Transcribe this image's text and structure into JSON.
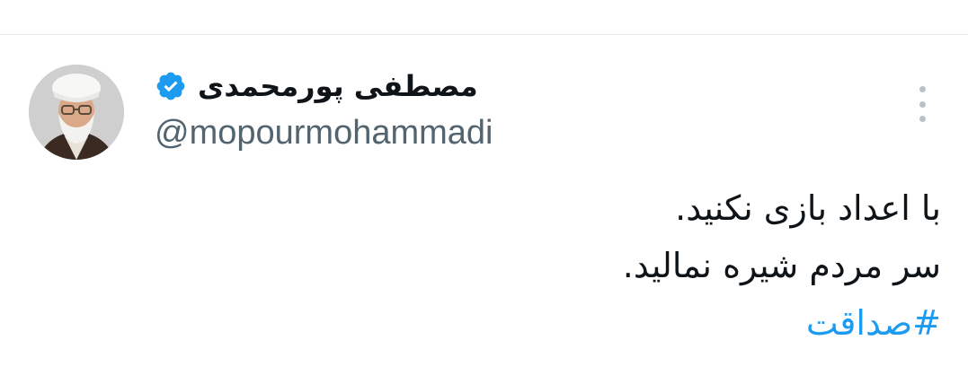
{
  "tweet": {
    "author": {
      "display_name": "مصطفی پورمحمدی",
      "handle": "@mopourmohammadi",
      "verified": true,
      "avatar": "author-avatar"
    },
    "body_lines": [
      "با اعداد بازی نکنید.",
      "سر مردم شیره نمالید."
    ],
    "hashtag": "#صداقت"
  },
  "colors": {
    "text": "#0f1419",
    "secondary_text": "#536471",
    "link": "#1d9bf0",
    "verified_badge": "#1d9bf0",
    "divider": "#e6ecf0"
  },
  "icons": {
    "verified": "verified-badge-icon",
    "more": "more-options-icon"
  }
}
